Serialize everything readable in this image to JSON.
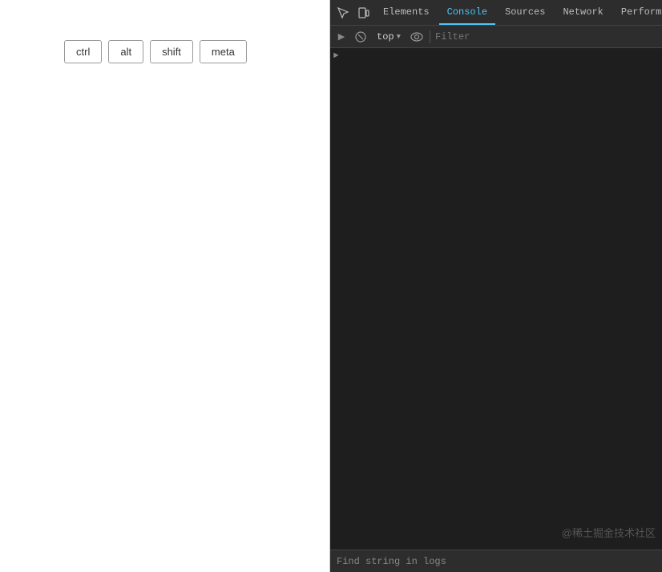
{
  "left_panel": {
    "keys": [
      {
        "label": "ctrl",
        "id": "ctrl"
      },
      {
        "label": "alt",
        "id": "alt"
      },
      {
        "label": "shift",
        "id": "shift"
      },
      {
        "label": "meta",
        "id": "meta"
      }
    ]
  },
  "devtools": {
    "tabs": [
      {
        "label": "Elements",
        "active": false
      },
      {
        "label": "Console",
        "active": true
      },
      {
        "label": "Sources",
        "active": false
      },
      {
        "label": "Network",
        "active": false
      },
      {
        "label": "Performa",
        "active": false
      }
    ],
    "toolbar": {
      "top_label": "top",
      "filter_placeholder": "Filter"
    },
    "bottom": {
      "find_label": "Find string in logs"
    },
    "watermark": "@稀土掘金技术社区"
  }
}
